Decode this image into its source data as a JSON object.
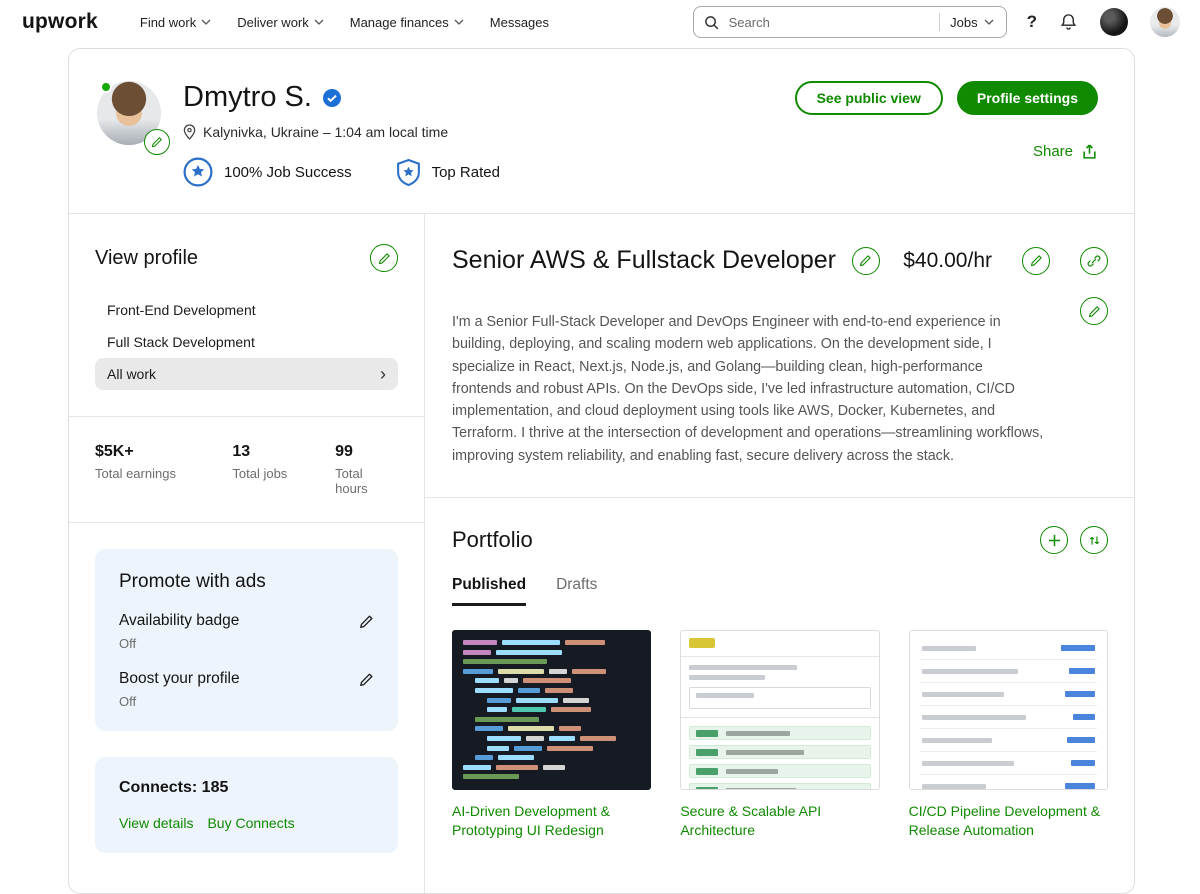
{
  "header": {
    "logo": "upwork",
    "nav": [
      {
        "label": "Find work",
        "dropdown": true
      },
      {
        "label": "Deliver work",
        "dropdown": true
      },
      {
        "label": "Manage finances",
        "dropdown": true
      },
      {
        "label": "Messages",
        "dropdown": false
      }
    ],
    "search": {
      "placeholder": "Search",
      "scope": "Jobs"
    }
  },
  "profile": {
    "name": "Dmytro S.",
    "verified": true,
    "location": "Kalynivka, Ukraine – 1:04 am local time",
    "badges": [
      {
        "label": "100% Job Success"
      },
      {
        "label": "Top Rated"
      }
    ],
    "see_public_view": "See public view",
    "profile_settings": "Profile settings",
    "share": "Share"
  },
  "sidebar": {
    "title": "View profile",
    "items": [
      {
        "label": "Front-End Development",
        "selected": false
      },
      {
        "label": "Full Stack Development",
        "selected": false
      },
      {
        "label": "All work",
        "selected": true
      }
    ],
    "stats": [
      {
        "value": "$5K+",
        "label": "Total earnings"
      },
      {
        "value": "13",
        "label": "Total jobs"
      },
      {
        "value": "99",
        "label": "Total hours"
      }
    ],
    "promote": {
      "title": "Promote with ads",
      "rows": [
        {
          "label": "Availability badge",
          "status": "Off"
        },
        {
          "label": "Boost your profile",
          "status": "Off"
        }
      ]
    },
    "connects": {
      "label": "Connects: 185",
      "links": [
        "View details",
        "Buy Connects"
      ]
    }
  },
  "main": {
    "title": "Senior AWS & Fullstack Developer",
    "rate": "$40.00/hr",
    "description": "I'm a Senior Full-Stack Developer and DevOps Engineer with end-to-end experience in building, deploying, and scaling modern web applications. On the development side, I specialize in React, Next.js, Node.js, and Golang—building clean, high-performance frontends and robust APIs. On the DevOps side, I've led infrastructure automation, CI/CD implementation, and cloud deployment using tools like AWS, Docker, Kubernetes, and Terraform. I thrive at the intersection of development and operations—streamlining workflows, improving system reliability, and enabling fast, secure delivery across the stack.",
    "portfolio": {
      "title": "Portfolio",
      "tabs": [
        {
          "label": "Published",
          "active": true
        },
        {
          "label": "Drafts",
          "active": false
        }
      ],
      "items": [
        {
          "title": "AI-Driven Development & Prototyping UI Redesign"
        },
        {
          "title": "Secure & Scalable API Architecture"
        },
        {
          "title": "CI/CD Pipeline Development & Release Automation"
        }
      ]
    }
  },
  "icons": {
    "help": "?",
    "chevron_right": "›",
    "plus_label": "add portfolio item",
    "sort_label": "reorder portfolio"
  },
  "colors": {
    "brand_green": "#108a00",
    "badge_blue": "#2b6fc9",
    "verified_blue": "#1c6fd4",
    "online_green": "#14a800",
    "panel_blue": "#eef4fb",
    "selected_gray": "#e9e9e9"
  }
}
